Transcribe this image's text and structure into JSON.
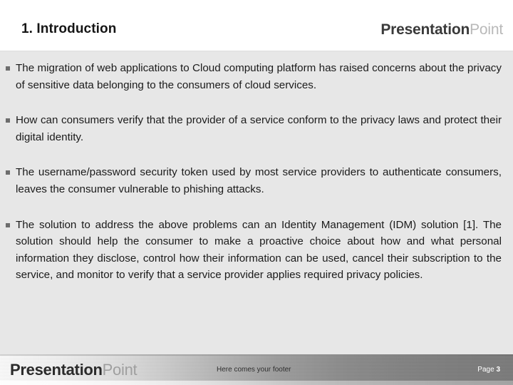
{
  "header": {
    "title": "1. Introduction",
    "logo_strong": "Presentation",
    "logo_light": "Point"
  },
  "body": {
    "bullet_marker_icon": "square-bullet-icon",
    "bullets": [
      "The migration of web applications to Cloud computing platform has raised concerns about the privacy of sensitive data belonging to the consumers of cloud services.",
      "How can consumers verify that the provider of a service conform to the privacy laws and protect their digital identity.",
      "The username/password security token used by most service providers to authenticate consumers, leaves the consumer vulnerable to phishing attacks.",
      "The solution to address the above problems can an Identity Management (IDM) solution [1]. The solution should help the consumer to make a proactive choice about how and what personal information they disclose, control how their information can be used, cancel their subscription to the service, and monitor to verify that a service provider applies required privacy policies."
    ]
  },
  "footer": {
    "logo_strong": "Presentation",
    "logo_light": "Point",
    "center_text": "Here comes your footer",
    "page_label": "Page",
    "page_number": "3"
  },
  "colors": {
    "slide_background": "#e7e7e7",
    "header_background": "#ffffff",
    "text": "#1b1b1b",
    "bullet_marker": "#6d6d6d",
    "logo_strong": "#3a3a3a",
    "logo_light": "#b9b9b9"
  }
}
